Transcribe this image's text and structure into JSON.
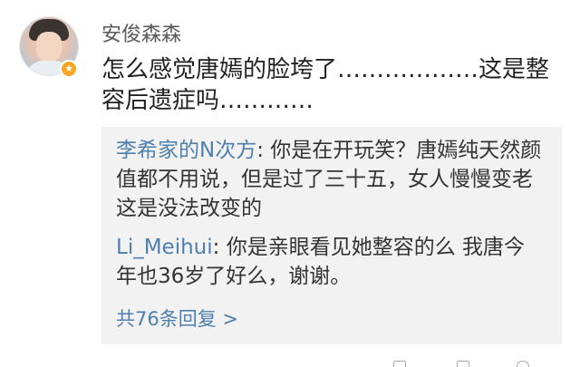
{
  "comment": {
    "username": "安俊森森",
    "verified_badge": "v-badge-icon",
    "text": "怎么感觉唐嫣的脸垮了………………这是整容后遗症吗…………",
    "replies": [
      {
        "author": "李希家的N次方",
        "separator": ": ",
        "text": "你是在开玩笑？唐嫣纯天然颜值都不用说，但是过了三十五，女人慢慢变老这是没法改变的"
      },
      {
        "author": "Li_Meihui",
        "separator": ": ",
        "text": "你是亲眼看见她整容的么 我唐今年也36岁了好么，谢谢。"
      }
    ],
    "more_replies": "共76条回复 >"
  },
  "colors": {
    "link": "#4d7fb0",
    "reply_bg": "#f2f2f2",
    "badge": "#f5a623"
  }
}
